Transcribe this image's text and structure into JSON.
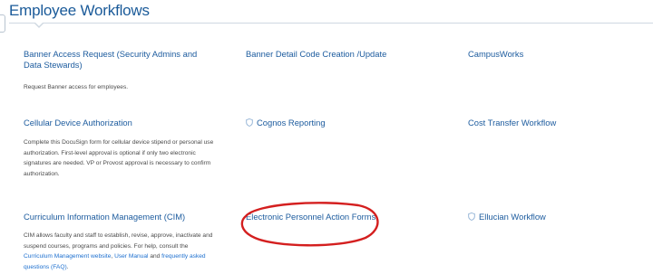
{
  "header": {
    "title": "Employee Workflows"
  },
  "cards": {
    "banner_access": {
      "title": "Banner Access Request (Security Admins and Data Stewards)",
      "description": "Request Banner access for employees."
    },
    "banner_detail": {
      "title": "Banner Detail Code Creation /Update"
    },
    "campusworks": {
      "title": "CampusWorks"
    },
    "cellular": {
      "title": "Cellular Device Authorization",
      "description": "Complete this DocuSign form for cellular device stipend or personal use authorization. First-level approval is optional if only two electronic signatures are needed. VP or Provost approval is necessary to confirm authorization."
    },
    "cognos": {
      "title": "Cognos Reporting",
      "icon": "shield-icon"
    },
    "cost_transfer": {
      "title": "Cost Transfer Workflow"
    },
    "cim": {
      "title": "Curriculum Information Management (CIM)",
      "description_text": "CIM allows faculty and staff to establish, revise, approve, inactivate and suspend courses, programs and policies. For help, consult the",
      "link_website": "Curriculum Management website",
      "sep1": ",",
      "link_manual": "User Manual",
      "sep2": "and",
      "link_faq": "frequently asked questions (FAQ)",
      "end": "."
    },
    "epaf": {
      "title": "Electronic Personnel Action Forms"
    },
    "ellucian": {
      "title": "Ellucian Workflow",
      "icon": "shield-icon"
    }
  },
  "colors": {
    "title": "#1a5a99",
    "link": "#1c5b9e",
    "inline_link": "#1c6fcf",
    "highlight": "#d41f1f",
    "text": "#4a4a4a"
  }
}
